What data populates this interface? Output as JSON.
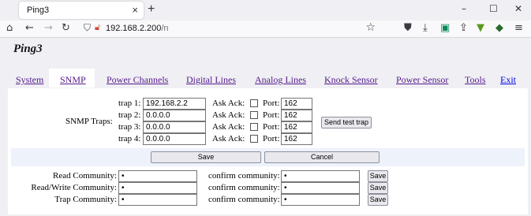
{
  "browser": {
    "tab_title": "Ping3",
    "tab_close_icon": "×",
    "new_tab_icon": "+",
    "url_host": "192.168.2.200",
    "url_path": "/n"
  },
  "page": {
    "logo": "Ping3",
    "menu": [
      {
        "label": "System"
      },
      {
        "label": "SNMP"
      },
      {
        "label": "Power Channels"
      },
      {
        "label": "Digital Lines"
      },
      {
        "label": "Analog Lines"
      },
      {
        "label": "Knock Sensor"
      },
      {
        "label": "Power Sensor"
      },
      {
        "label": "Tools"
      },
      {
        "label": "Exit"
      }
    ],
    "active_menu": "SNMP"
  },
  "snmp": {
    "traps_label": "SNMP Traps:",
    "ask_ack_label": "Ask Ack:",
    "port_label": "Port:",
    "traps": [
      {
        "label": "trap 1:",
        "address": "192.168.2.2",
        "ask_ack": false,
        "port": "162"
      },
      {
        "label": "trap 2:",
        "address": "0.0.0.0",
        "ask_ack": false,
        "port": "162"
      },
      {
        "label": "trap 3:",
        "address": "0.0.0.0",
        "ask_ack": false,
        "port": "162"
      },
      {
        "label": "trap 4:",
        "address": "0.0.0.0",
        "ask_ack": false,
        "port": "162"
      }
    ],
    "send_test_trap": "Send test trap",
    "save": "Save",
    "cancel": "Cancel",
    "communities": [
      {
        "label": "Read Community:",
        "value": "•",
        "confirm_label": "confirm community:",
        "confirm_value": "•",
        "save": "Save"
      },
      {
        "label": "Read/Write Community:",
        "value": "•",
        "confirm_label": "confirm community:",
        "confirm_value": "•",
        "save": "Save"
      },
      {
        "label": "Trap Community:",
        "value": "•",
        "confirm_label": "confirm community:",
        "confirm_value": "•",
        "save": "Save"
      }
    ]
  }
}
